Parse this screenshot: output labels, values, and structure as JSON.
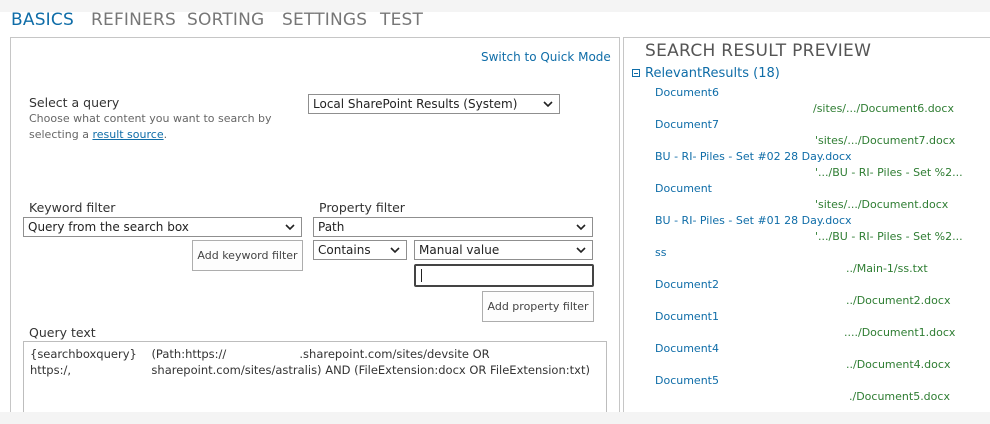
{
  "tabs": [
    {
      "label": "BASICS",
      "active": true
    },
    {
      "label": "REFINERS"
    },
    {
      "label": "SORTING"
    },
    {
      "label": "SETTINGS"
    },
    {
      "label": "TEST"
    }
  ],
  "basics": {
    "switch_mode_link": "Switch to Quick Mode",
    "select_query": {
      "label": "Select a query",
      "help_line1": "Choose what content you want to search by",
      "help_prefix": "selecting a ",
      "help_link": "result source",
      "help_suffix": ".",
      "selected": "Local SharePoint Results (System)"
    },
    "keyword_filter": {
      "label": "Keyword filter",
      "selected": "Query from the search box",
      "add_button": "Add keyword filter"
    },
    "property_filter": {
      "label": "Property filter",
      "property_selected": "Path",
      "operator_selected": "Contains",
      "value_source_selected": "Manual value",
      "value_input": "",
      "add_button": "Add property filter"
    },
    "query_text": {
      "label": "Query text",
      "value": "{searchboxquery}    (Path:https://                    .sharepoint.com/sites/devsite OR\nhttps:/,                      sharepoint.com/sites/astralis) AND (FileExtension:docx OR FileExtension:txt)"
    }
  },
  "preview": {
    "title": "SEARCH RESULT PREVIEW",
    "group_label": "RelevantResults (18)",
    "results": [
      {
        "title": "Document6",
        "path": "/sites/.../Document6.docx"
      },
      {
        "title": "Document7",
        "path": "'sites/.../Document7.docx"
      },
      {
        "title": "BU - RI- Piles - Set #02 28 Day.docx",
        "path": "'.../BU - RI- Piles - Set %2..."
      },
      {
        "title": "Document",
        "path": "'sites/.../Document.docx"
      },
      {
        "title": "BU - RI- Piles - Set #01 28 Day.docx",
        "path": "'.../BU - RI- Piles - Set %2..."
      },
      {
        "title": "ss",
        "path": "../Main-1/ss.txt"
      },
      {
        "title": "Document2",
        "path": "../Document2.docx"
      },
      {
        "title": "Document1",
        "path": "..../Document1.docx"
      },
      {
        "title": "Document4",
        "path": "../Document4.docx"
      },
      {
        "title": "Document5",
        "path": "./Document5.docx"
      }
    ]
  },
  "colors": {
    "accent": "#0f6da8",
    "path_green": "#2e7d32",
    "border": "#c6c6c6"
  },
  "icons": {
    "dropdown": "chevron-down-icon",
    "collapse": "collapse-minus-icon"
  }
}
